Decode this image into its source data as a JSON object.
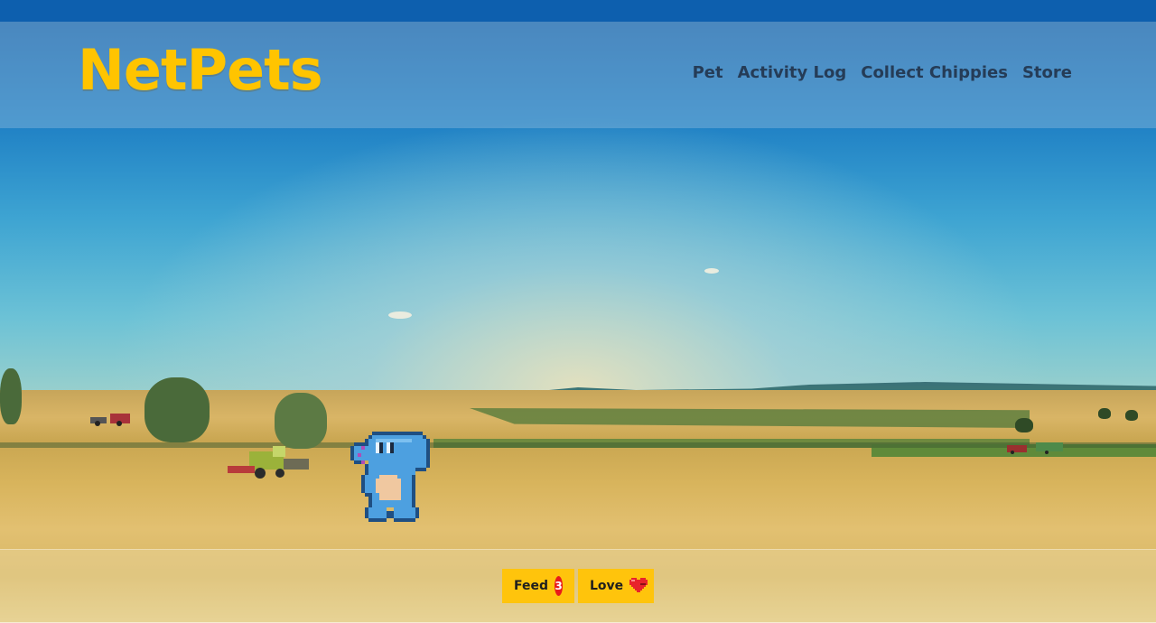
{
  "app": {
    "logo": "NetPets"
  },
  "nav": {
    "items": [
      {
        "label": "Pet"
      },
      {
        "label": "Activity Log"
      },
      {
        "label": "Collect Chippies"
      },
      {
        "label": "Store"
      }
    ]
  },
  "pet": {
    "icon": "blue-dinosaur-pixel-icon"
  },
  "actions": {
    "feed": {
      "label": "Feed",
      "count": "3"
    },
    "love": {
      "label": "Love",
      "icon": "heart-icon"
    }
  },
  "colors": {
    "brand": "#ffc400",
    "button": "#ffc40c",
    "badge": "#e81b1b",
    "nav_text": "#253c57",
    "header_top": "#0d5fae"
  }
}
